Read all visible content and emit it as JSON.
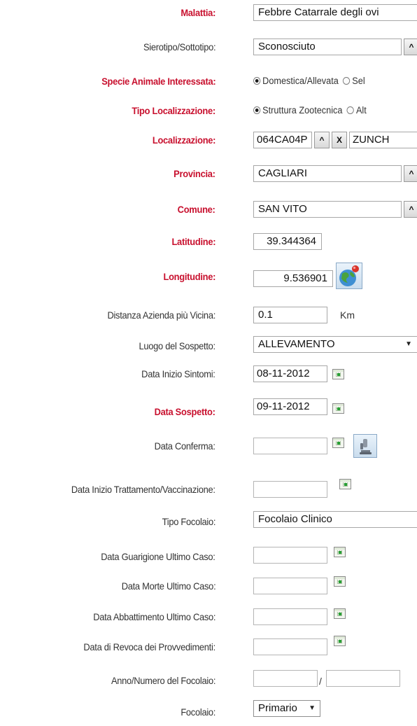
{
  "form": {
    "malattia": {
      "label": "Malattia:",
      "value": "Febbre Catarrale degli ovi"
    },
    "sierotipo": {
      "label": "Sierotipo/Sottotipo:",
      "value": "Sconosciuto",
      "button": "^"
    },
    "specie": {
      "label": "Specie Animale Interessata:",
      "options": [
        "Domestica/Allevata",
        "Sel"
      ],
      "selected": "Domestica/Allevata"
    },
    "tipo_localizzazione": {
      "label": "Tipo Localizzazione:",
      "options": [
        "Struttura Zootecnica",
        "Alt"
      ],
      "selected": "Struttura Zootecnica"
    },
    "localizzazione": {
      "label": "Localizzazione:",
      "code": "064CA04P",
      "button_up": "^",
      "button_clear": "X",
      "name": "ZUNCH"
    },
    "provincia": {
      "label": "Provincia:",
      "value": "CAGLIARI",
      "button": "^"
    },
    "comune": {
      "label": "Comune:",
      "value": "SAN VITO",
      "button": "^"
    },
    "latitudine": {
      "label": "Latitudine:",
      "value": "39.344364"
    },
    "longitudine": {
      "label": "Longitudine:",
      "value": "9.536901"
    },
    "distanza": {
      "label": "Distanza Azienda più Vicina:",
      "value": "0.1",
      "unit": "Km"
    },
    "luogo_sospetto": {
      "label": "Luogo del Sospetto:",
      "value": "ALLEVAMENTO"
    },
    "data_inizio_sintomi": {
      "label": "Data Inizio Sintomi:",
      "value": "08-11-2012"
    },
    "data_sospetto": {
      "label": "Data Sospetto:",
      "value": "09-11-2012"
    },
    "data_conferma": {
      "label": "Data Conferma:",
      "value": ""
    },
    "data_inizio_trattamento": {
      "label": "Data Inizio Trattamento/Vaccinazione:",
      "value": ""
    },
    "tipo_focolaio": {
      "label": "Tipo Focolaio:",
      "value": "Focolaio Clinico"
    },
    "data_guarigione": {
      "label": "Data Guarigione Ultimo Caso:",
      "value": ""
    },
    "data_morte": {
      "label": "Data Morte Ultimo Caso:",
      "value": ""
    },
    "data_abbattimento": {
      "label": "Data Abbattimento Ultimo Caso:",
      "value": ""
    },
    "data_revoca": {
      "label": "Data di Revoca dei Provvedimenti:",
      "value": ""
    },
    "anno_numero": {
      "label": "Anno/Numero del Focolaio:",
      "separator": "/",
      "anno": "",
      "numero": ""
    },
    "focolaio": {
      "label": "Focolaio:",
      "value": "Primario"
    }
  },
  "icons": {
    "calendar": "calendar-icon",
    "globe": "globe-map-icon",
    "lab": "microscope-icon"
  },
  "colors": {
    "required_label": "#c8102e",
    "label": "#333333",
    "border": "#a7a7a7"
  }
}
